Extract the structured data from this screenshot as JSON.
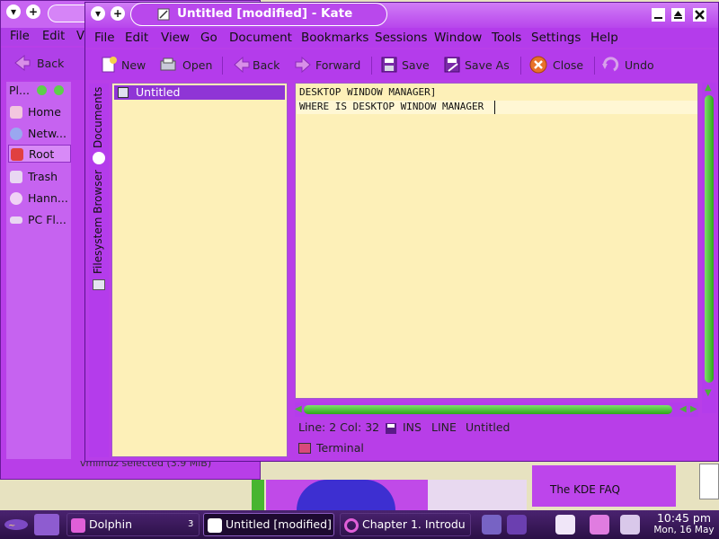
{
  "kate": {
    "title": "Untitled [modified] - Kate",
    "menu": [
      "File",
      "Edit",
      "View",
      "Go",
      "Document",
      "Bookmarks",
      "Sessions",
      "Window",
      "Tools",
      "Settings",
      "Help"
    ],
    "toolbar": {
      "new": "New",
      "open": "Open",
      "back": "Back",
      "forward": "Forward",
      "save": "Save",
      "save_as": "Save As",
      "close": "Close",
      "undo": "Undo"
    },
    "side_tabs": {
      "documents": "Documents",
      "filesystem": "Filesystem Browser"
    },
    "documents": [
      "Untitled"
    ],
    "editor_lines": [
      "DESKTOP WINDOW MANAGER]",
      "WHERE IS DESKTOP WINDOW MANAGER"
    ],
    "status": {
      "position": "Line: 2 Col: 32",
      "mode": "INS",
      "sel": "LINE",
      "doc": "Untitled"
    },
    "terminal_tab": "Terminal"
  },
  "dolphin": {
    "menu": [
      "File",
      "Edit",
      "V"
    ],
    "back": "Back",
    "places_title": "Pl...",
    "places": [
      {
        "label": "Home",
        "color": "#f3c7df"
      },
      {
        "label": "Netw...",
        "color": "#9aa7f0"
      },
      {
        "label": "Root",
        "color": "#e04040"
      },
      {
        "label": "Trash",
        "color": "#e9d7f2"
      },
      {
        "label": "Hann...",
        "color": "#f0d2f5"
      },
      {
        "label": "PC Fl...",
        "color": "#e9d7f2"
      }
    ],
    "selected_place": "Root",
    "status_text": "vmlinuz  selected (3.9 MiB)"
  },
  "background": {
    "faq_text": "The KDE FAQ"
  },
  "taskbar": {
    "tasks": [
      {
        "label": "Dolphin",
        "count": "3"
      },
      {
        "label": "Untitled [modified]"
      },
      {
        "label": "Chapter 1. Introdu"
      }
    ],
    "clock_time": "10:45 pm",
    "clock_date": "Mon, 16 May"
  },
  "colors": {
    "accent": "#b43ceb",
    "editor_bg": "#fdf0b8",
    "scroll": "#3db52a"
  }
}
